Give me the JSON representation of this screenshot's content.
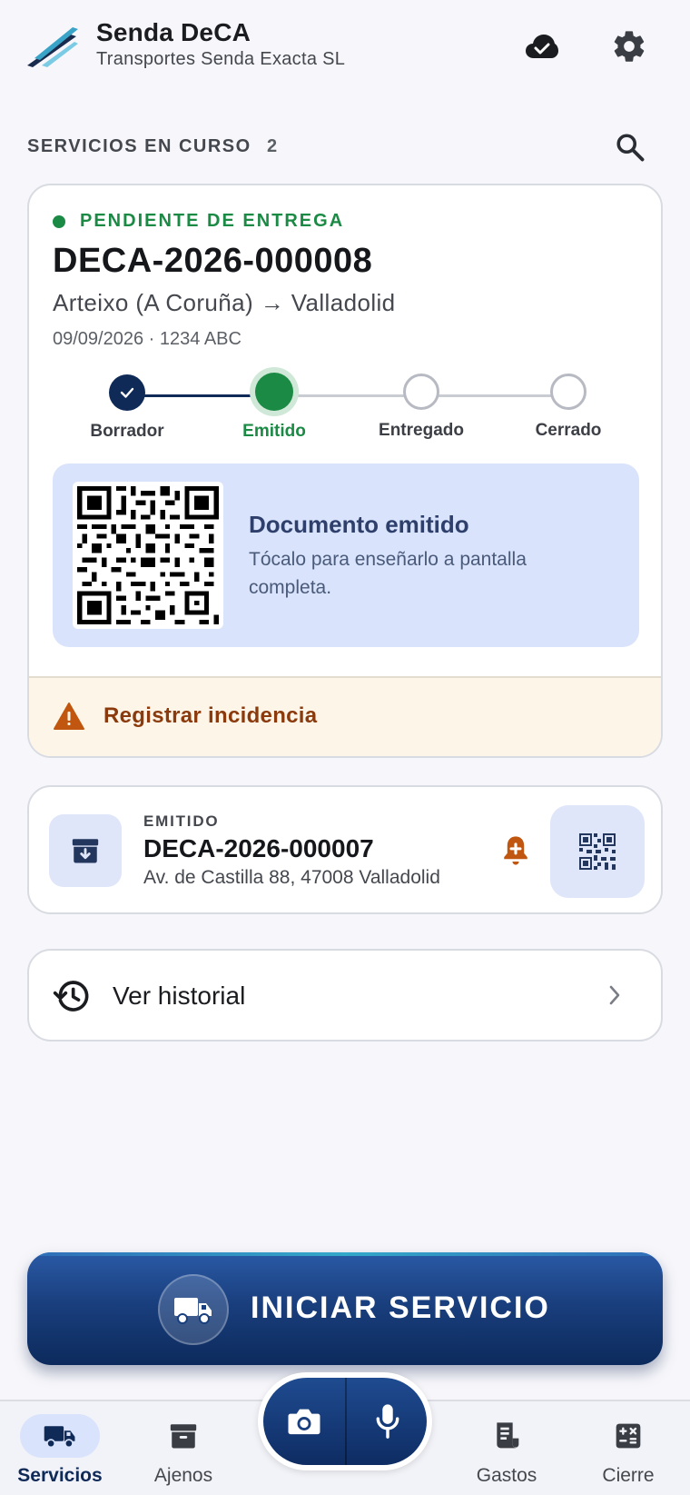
{
  "header": {
    "title": "Senda DeCA",
    "subtitle": "Transportes Senda Exacta SL",
    "icons": [
      "cloud-done-icon",
      "gear-icon"
    ]
  },
  "section": {
    "title": "SERVICIOS EN CURSO",
    "count": "2"
  },
  "current_service": {
    "status": "PENDIENTE DE ENTREGA",
    "status_color": "#1a8a44",
    "doc_id": "DECA-2026-000008",
    "route": "Arteixo (A Coruña) → Valladolid",
    "meta": "09/09/2026 · 1234 ABC",
    "steps": [
      {
        "label": "Borrador",
        "state": "done"
      },
      {
        "label": "Emitido",
        "state": "active"
      },
      {
        "label": "Entregado",
        "state": "todo"
      },
      {
        "label": "Cerrado",
        "state": "todo"
      }
    ],
    "document_box": {
      "title": "Documento emitido",
      "text": "Tócalo para enseñarlo a pantalla completa."
    },
    "incident_label": "Registrar incidencia"
  },
  "second_service": {
    "status": "EMITIDO",
    "doc_id": "DECA-2026-000007",
    "address": "Av. de Castilla 88, 47008 Valladolid"
  },
  "history": {
    "label": "Ver historial"
  },
  "cta": {
    "label": "INICIAR SERVICIO"
  },
  "bottom_nav": {
    "items": [
      {
        "label": "Servicios",
        "icon": "truck-icon",
        "active": true
      },
      {
        "label": "Ajenos",
        "icon": "archive-icon",
        "active": false
      },
      {
        "label": "Gastos",
        "icon": "receipt-icon",
        "active": false
      },
      {
        "label": "Cierre",
        "icon": "calculator-icon",
        "active": false
      }
    ],
    "fab": {
      "left_icon": "camera-icon",
      "right_icon": "microphone-icon"
    }
  },
  "colors": {
    "brand_navy": "#0f2a57",
    "accent_green": "#1a8a44",
    "warning": "#c0560f",
    "tile_blue": "#d9e3fb"
  }
}
